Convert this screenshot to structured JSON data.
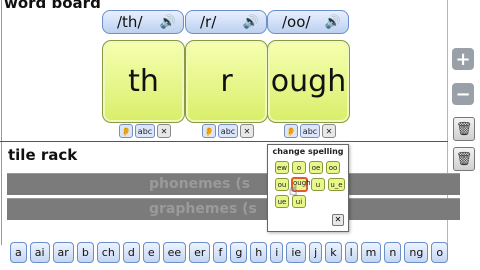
{
  "word_board": {
    "title": "word board",
    "phonemes": [
      "/th/",
      "/r/",
      "/oo/"
    ],
    "tiles": [
      "th",
      "r",
      "ough"
    ],
    "tile_controls": {
      "abc_label": "abc",
      "close_label": "✕"
    }
  },
  "tile_rack": {
    "title": "tile rack",
    "phonemes_label": "phonemes (s",
    "graphemes_label": "graphemes (s"
  },
  "side_controls": {
    "plus_label": "+",
    "minus_label": "−"
  },
  "popup": {
    "title": "change spelling",
    "options": [
      "ew",
      "o",
      "oe",
      "oo",
      "ou",
      "ough",
      "u",
      "u_e",
      "ue",
      "ui"
    ],
    "selected": "ough",
    "close_label": "✕"
  },
  "keyboard": {
    "keys": [
      "a",
      "ai",
      "ar",
      "b",
      "ch",
      "d",
      "e",
      "ee",
      "er",
      "f",
      "g",
      "h",
      "i",
      "ie",
      "j",
      "k",
      "l",
      "m",
      "n",
      "ng",
      "o"
    ]
  },
  "colors": {
    "tile": "#e2f27c",
    "button": "#c5d6f3",
    "rack_band": "#7b7b7b"
  },
  "icons": [
    "speaker-icon",
    "ear-icon",
    "plus-icon",
    "minus-icon",
    "trash-icon",
    "hand-cursor-icon"
  ]
}
